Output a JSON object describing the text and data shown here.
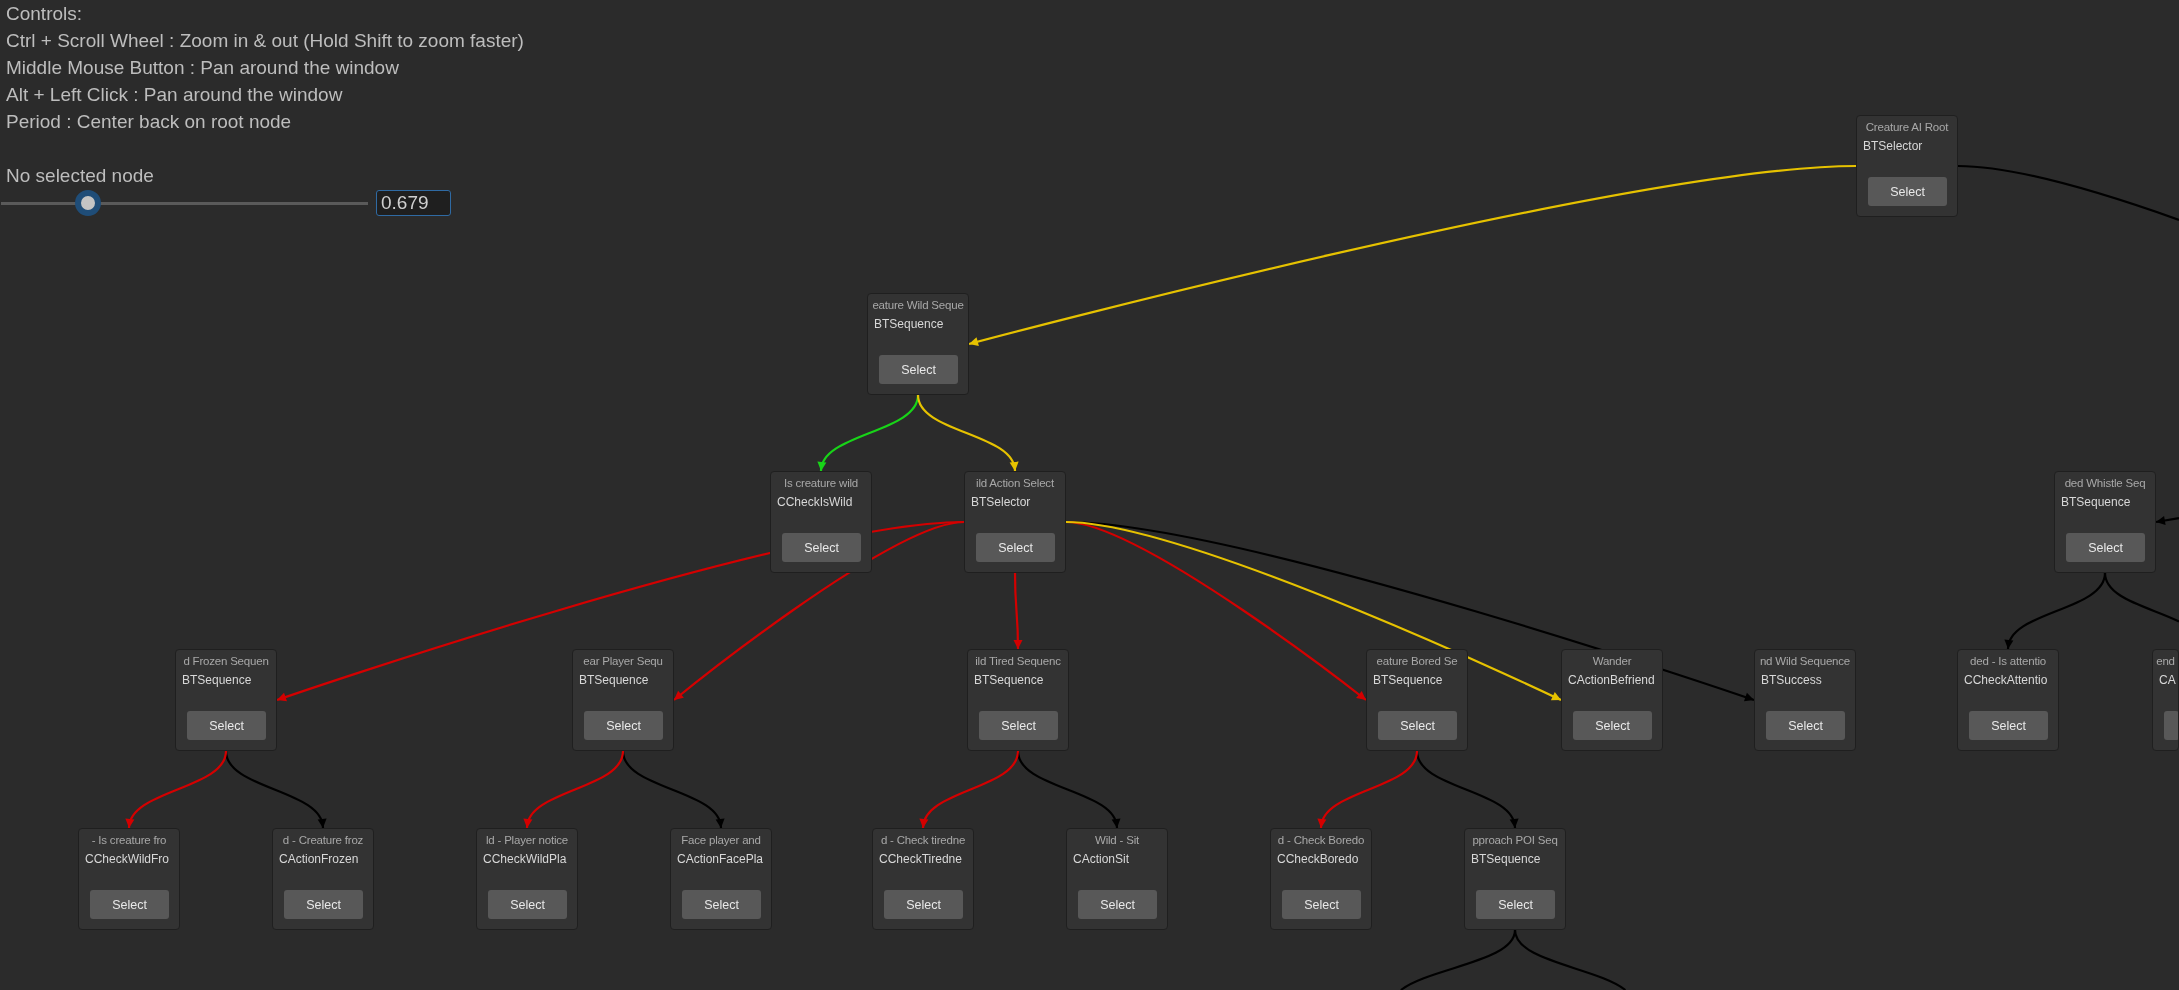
{
  "help": {
    "lines": [
      "Controls:",
      "Ctrl + Scroll Wheel : Zoom in & out (Hold Shift to zoom faster)",
      "Middle Mouse Button : Pan around the window",
      "Alt + Left Click : Pan around the window",
      "Period : Center back on root node"
    ]
  },
  "selection_status": "No selected node",
  "zoom": {
    "level": 0.236,
    "value": "0.679"
  },
  "graph": {
    "root": {
      "title": "Creature AI Root",
      "type": "BTSelector",
      "button": "Select",
      "children": [
        {
          "edge": {
            "color": "#e6c200"
          },
          "title": "eature Wild Seque",
          "type": "BTSequence",
          "button": "Select",
          "children": [
            {
              "edge": {
                "color": "#18d418"
              },
              "title": "Is creature wild",
              "type": "CCheckIsWild",
              "button": "Select"
            },
            {
              "edge": {
                "color": "#e6c200"
              },
              "title": "ild Action Select",
              "type": "BTSelector",
              "button": "Select",
              "children": [
                {
                  "edge": {
                    "color": "#d40000"
                  },
                  "title": "d Frozen Sequen",
                  "type": "BTSequence",
                  "button": "Select",
                  "children": [
                    {
                      "edge": {
                        "color": "#d40000"
                      },
                      "title": "- Is creature fro",
                      "type": "CCheckWildFro",
                      "button": "Select"
                    },
                    {
                      "edge": {
                        "color": "#000000"
                      },
                      "title": "d - Creature froz",
                      "type": "CActionFrozen",
                      "button": "Select"
                    }
                  ]
                },
                {
                  "edge": {
                    "color": "#d40000"
                  },
                  "title": "ear Player Sequ",
                  "type": "BTSequence",
                  "button": "Select",
                  "children": [
                    {
                      "edge": {
                        "color": "#d40000"
                      },
                      "title": "ld - Player notice",
                      "type": "CCheckWildPla",
                      "button": "Select"
                    },
                    {
                      "edge": {
                        "color": "#000000"
                      },
                      "title": "Face player and",
                      "type": "CActionFacePla",
                      "button": "Select"
                    }
                  ]
                },
                {
                  "edge": {
                    "color": "#d40000"
                  },
                  "title": "ild Tired Sequenc",
                  "type": "BTSequence",
                  "button": "Select",
                  "children": [
                    {
                      "edge": {
                        "color": "#d40000"
                      },
                      "title": "d - Check tiredne",
                      "type": "CCheckTiredne",
                      "button": "Select"
                    },
                    {
                      "edge": {
                        "color": "#000000"
                      },
                      "title": "Wild - Sit",
                      "type": "CActionSit",
                      "button": "Select"
                    }
                  ]
                },
                {
                  "edge": {
                    "color": "#d40000"
                  },
                  "title": "eature Bored Se",
                  "type": "BTSequence",
                  "button": "Select",
                  "children": [
                    {
                      "edge": {
                        "color": "#d40000"
                      },
                      "title": "d - Check Boredo",
                      "type": "CCheckBoredo",
                      "button": "Select"
                    },
                    {
                      "edge": {
                        "color": "#000000"
                      },
                      "title": "pproach POI Seq",
                      "type": "BTSequence",
                      "button": "Select",
                      "children": [
                        {
                          "edge": {
                            "color": "#000000"
                          }
                        },
                        {
                          "edge": {
                            "color": "#000000"
                          }
                        }
                      ]
                    }
                  ]
                },
                {
                  "edge": {
                    "color": "#e6c200"
                  },
                  "title": "Wander",
                  "type": "CActionBefriend",
                  "button": "Select"
                },
                {
                  "edge": {
                    "color": "#000000"
                  },
                  "title": "nd Wild Sequence",
                  "type": "BTSuccess",
                  "button": "Select"
                }
              ]
            }
          ]
        },
        {
          "edge": {
            "color": "#000000"
          },
          "children": [
            {
              "edge": {
                "color": "#000000"
              },
              "title": "ded Whistle Seq",
              "type": "BTSequence",
              "button": "Select",
              "children": [
                {
                  "edge": {
                    "color": "#000000"
                  },
                  "title": "ded - Is attentio",
                  "type": "CCheckAttentio",
                  "button": "Select"
                },
                {
                  "edge": {
                    "color": "#000000"
                  },
                  "title": "end",
                  "type": "CA"
                }
              ]
            }
          ]
        }
      ]
    }
  }
}
